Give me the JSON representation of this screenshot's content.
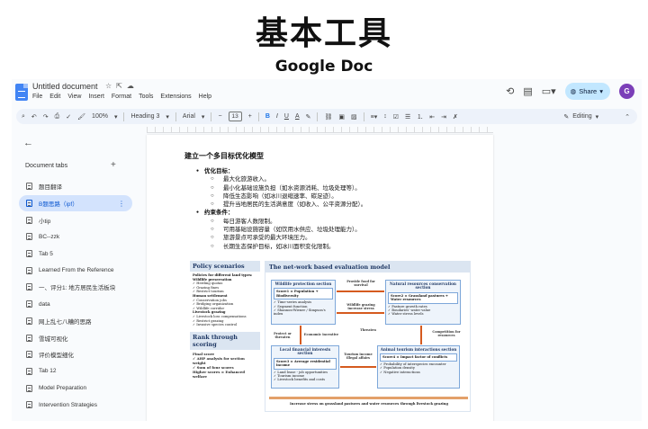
{
  "header": {
    "title": "基本工具",
    "subtitle": "Google Doc"
  },
  "app": {
    "doc_title": "Untitled document",
    "title_icons": [
      "star-icon",
      "move-icon",
      "cloud-icon"
    ],
    "menu": [
      "File",
      "Edit",
      "View",
      "Insert",
      "Format",
      "Tools",
      "Extensions",
      "Help"
    ],
    "share_label": "Share",
    "avatar_initial": "G",
    "accent": "#c2e7ff"
  },
  "toolbar": {
    "zoom": "100%",
    "style": "Heading 3",
    "font": "Arial",
    "size": "13",
    "bold": "B",
    "italic": "I",
    "underline": "U",
    "text_color": "A",
    "mode": "Editing"
  },
  "sidebar": {
    "header": "Document tabs",
    "add": "+",
    "tabs": [
      {
        "label": "题目翻译",
        "active": false
      },
      {
        "label": "B题思路（ipf）",
        "active": true
      },
      {
        "label": "小tip",
        "active": false
      },
      {
        "label": "BC--zzk",
        "active": false
      },
      {
        "label": "Tab 5",
        "active": false
      },
      {
        "label": "Learned From the Reference",
        "active": false
      },
      {
        "label": "一、评分1: 地方居民生活板块",
        "active": false
      },
      {
        "label": "data",
        "active": false
      },
      {
        "label": "网上乱七八糟的思路",
        "active": false
      },
      {
        "label": "雪城可视化",
        "active": false
      },
      {
        "label": "评价模型细化",
        "active": false
      },
      {
        "label": "Tab 12",
        "active": false
      },
      {
        "label": "Model Preparation",
        "active": false
      },
      {
        "label": "Intervention Strategies",
        "active": false
      }
    ]
  },
  "doc": {
    "heading": "建立一个多目标优化模型",
    "sections": [
      {
        "label": "优化目标：",
        "items": [
          "最大化旅游收入。",
          "最小化基础设施负担（如水资源消耗、垃圾处理等）。",
          "降低生态影响（如冰川退缩速率、碳足迹）。",
          "提升当地居民的生活满意度（如收入、公平资源分配）。"
        ]
      },
      {
        "label": "约束条件：",
        "items": [
          "每日游客人数限制。",
          "可用基础设施容量（如饮用水供应、垃圾处理能力）。",
          "旅游景点可承受的最大环境压力。",
          "长期生态保护目标，如冰川面积变化限制。"
        ]
      }
    ]
  },
  "figure": {
    "policy_title": "Policy scenarios",
    "policy_lines": [
      {
        "text": "Policies for different land types:",
        "bold": true
      },
      {
        "text": "Wildlife preservation",
        "bold": true
      },
      {
        "text": "✓ Herding quotas",
        "bold": false
      },
      {
        "text": "✓ Grazing fines",
        "bold": false
      },
      {
        "text": "✓ Restrict tourism",
        "bold": false
      },
      {
        "text": "Human settlement",
        "bold": true
      },
      {
        "text": "✓ Conservation jobs",
        "bold": false
      },
      {
        "text": "✓ Bridging organization",
        "bold": false
      },
      {
        "text": "✓ Wildlife corridor",
        "bold": false
      },
      {
        "text": "Livestock grazing",
        "bold": true
      },
      {
        "text": "✓ Livestock loss compensations",
        "bold": false
      },
      {
        "text": "✓ Restrict grazing",
        "bold": false
      },
      {
        "text": "✓ Invasive species control",
        "bold": false
      }
    ],
    "rank_title": "Rank through scoring",
    "rank_lines": [
      "Final score",
      "✓ AHP analysis for section weight",
      "✓ Sum of four scores",
      "Higher scores = Enhanced welfare"
    ],
    "network_title": "The net-work based evaluation model",
    "boxes": {
      "wildlife": {
        "title": "Wildlife protection section",
        "formula": "Score1 = Population + Biodiversity",
        "items": [
          "✓ Time-series analysis",
          "✓ Segment function",
          "✓ Shannon-Wiener / Simpson's index"
        ]
      },
      "natural": {
        "title": "Natural resources conservation section",
        "formula": "Score2 = Grassland pastures + Water resources",
        "items": [
          "✓ Pasture growth rates",
          "✓ Boudaries' water value",
          "✓ Water stress levels"
        ]
      },
      "financial": {
        "title": "Local financial interests section",
        "formula": "Score3 = Average residential income",
        "items": [
          "✓ Land lease - job opportunities",
          "✓ Tourism income",
          "✓ Livestock benefits and costs"
        ]
      },
      "animal": {
        "title": "Animal tourism interactions section",
        "formula": "Score4 = Impact factor of conflicts",
        "items": [
          "✓ Probability of interspecies encounter",
          "✓ Population density",
          "✓ Negative interactions"
        ]
      }
    },
    "link_labels": {
      "provide_food": "Provide food for survival",
      "wildlife_grazing": "Wildlife grazing increase stress",
      "protect": "Protect or threaten",
      "economic": "Economic incentive",
      "threaten": "Threaten",
      "tourism": "Tourism income illegal affairs",
      "competition": "Competition for resources",
      "bottom": "Increase stress on grassland pastures and water resources through livestock grazing"
    }
  }
}
